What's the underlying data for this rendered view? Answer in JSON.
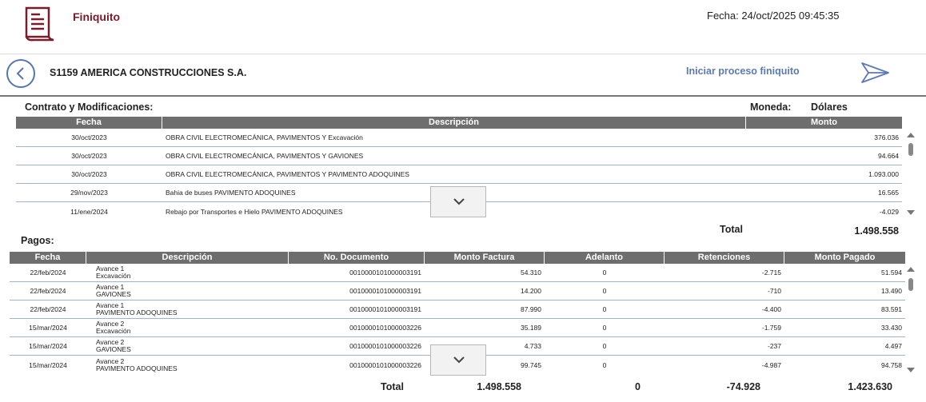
{
  "header": {
    "title": "Finiquito",
    "fecha": "Fecha: 24/oct/2025 09:45:35",
    "accent_color": "#7b1a2a"
  },
  "subbar": {
    "company": "S1159 AMERICA CONSTRUCCIONES S.A.",
    "action_label": "Iniciar proceso finiquito"
  },
  "contrato": {
    "section_label": "Contrato y Modificaciones:",
    "moneda_label": "Moneda:",
    "moneda_value": "Dólares",
    "columns": [
      "Fecha",
      "Descripción",
      "Monto"
    ],
    "rows": [
      {
        "fecha": "30/oct/2023",
        "descripcion": "OBRA CIVIL ELECTROMECÁNICA, PAVIMENTOS Y Excavación",
        "monto": "376.036"
      },
      {
        "fecha": "30/oct/2023",
        "descripcion": "OBRA CIVIL ELECTROMECÁNICA, PAVIMENTOS Y GAVIONES",
        "monto": "94.664"
      },
      {
        "fecha": "30/oct/2023",
        "descripcion": "OBRA CIVIL ELECTROMECÁNICA, PAVIMENTOS Y PAVIMENTO ADOQUINES",
        "monto": "1.093.000"
      },
      {
        "fecha": "29/nov/2023",
        "descripcion": "Bahia de buses PAVIMENTO ADOQUINES",
        "monto": "16.565"
      },
      {
        "fecha": "11/ene/2024",
        "descripcion": "Rebajo por Transportes e Hielo PAVIMENTO ADOQUINES",
        "monto": "-4.029"
      }
    ],
    "total_label": "Total",
    "total_value": "1.498.558"
  },
  "pagos": {
    "section_label": "Pagos:",
    "columns": [
      "Fecha",
      "Descripción",
      "No. Documento",
      "Monto Factura",
      "Adelanto",
      "Retenciones",
      "Monto Pagado"
    ],
    "rows": [
      {
        "fecha": "22/feb/2024",
        "desc1": "Avance 1",
        "desc2": "Excavación",
        "documento": "0010000101000003191",
        "factura": "54.310",
        "adelanto": "0",
        "retenciones": "-2.715",
        "pagado": "51.594"
      },
      {
        "fecha": "22/feb/2024",
        "desc1": "Avance 1",
        "desc2": "GAVIONES",
        "documento": "0010000101000003191",
        "factura": "14.200",
        "adelanto": "0",
        "retenciones": "-710",
        "pagado": "13.490"
      },
      {
        "fecha": "22/feb/2024",
        "desc1": "Avance 1",
        "desc2": "PAVIMENTO ADOQUINES",
        "documento": "0010000101000003191",
        "factura": "87.990",
        "adelanto": "0",
        "retenciones": "-4.400",
        "pagado": "83.591"
      },
      {
        "fecha": "15/mar/2024",
        "desc1": "Avance 2",
        "desc2": "Excavación",
        "documento": "0010000101000003226",
        "factura": "35.189",
        "adelanto": "0",
        "retenciones": "-1.759",
        "pagado": "33.430"
      },
      {
        "fecha": "15/mar/2024",
        "desc1": "Avance 2",
        "desc2": "GAVIONES",
        "documento": "0010000101000003226",
        "factura": "4.733",
        "adelanto": "0",
        "retenciones": "-237",
        "pagado": "4.497"
      },
      {
        "fecha": "15/mar/2024",
        "desc1": "Avance 2",
        "desc2": "PAVIMENTO ADOQUINES",
        "documento": "0010000101000003226",
        "factura": "99.745",
        "adelanto": "0",
        "retenciones": "-4.987",
        "pagado": "94.758"
      }
    ],
    "total_label": "Total",
    "total_factura": "1.498.558",
    "total_adelanto": "0",
    "total_retenciones": "-74.928",
    "total_pagado": "1.423.630"
  }
}
